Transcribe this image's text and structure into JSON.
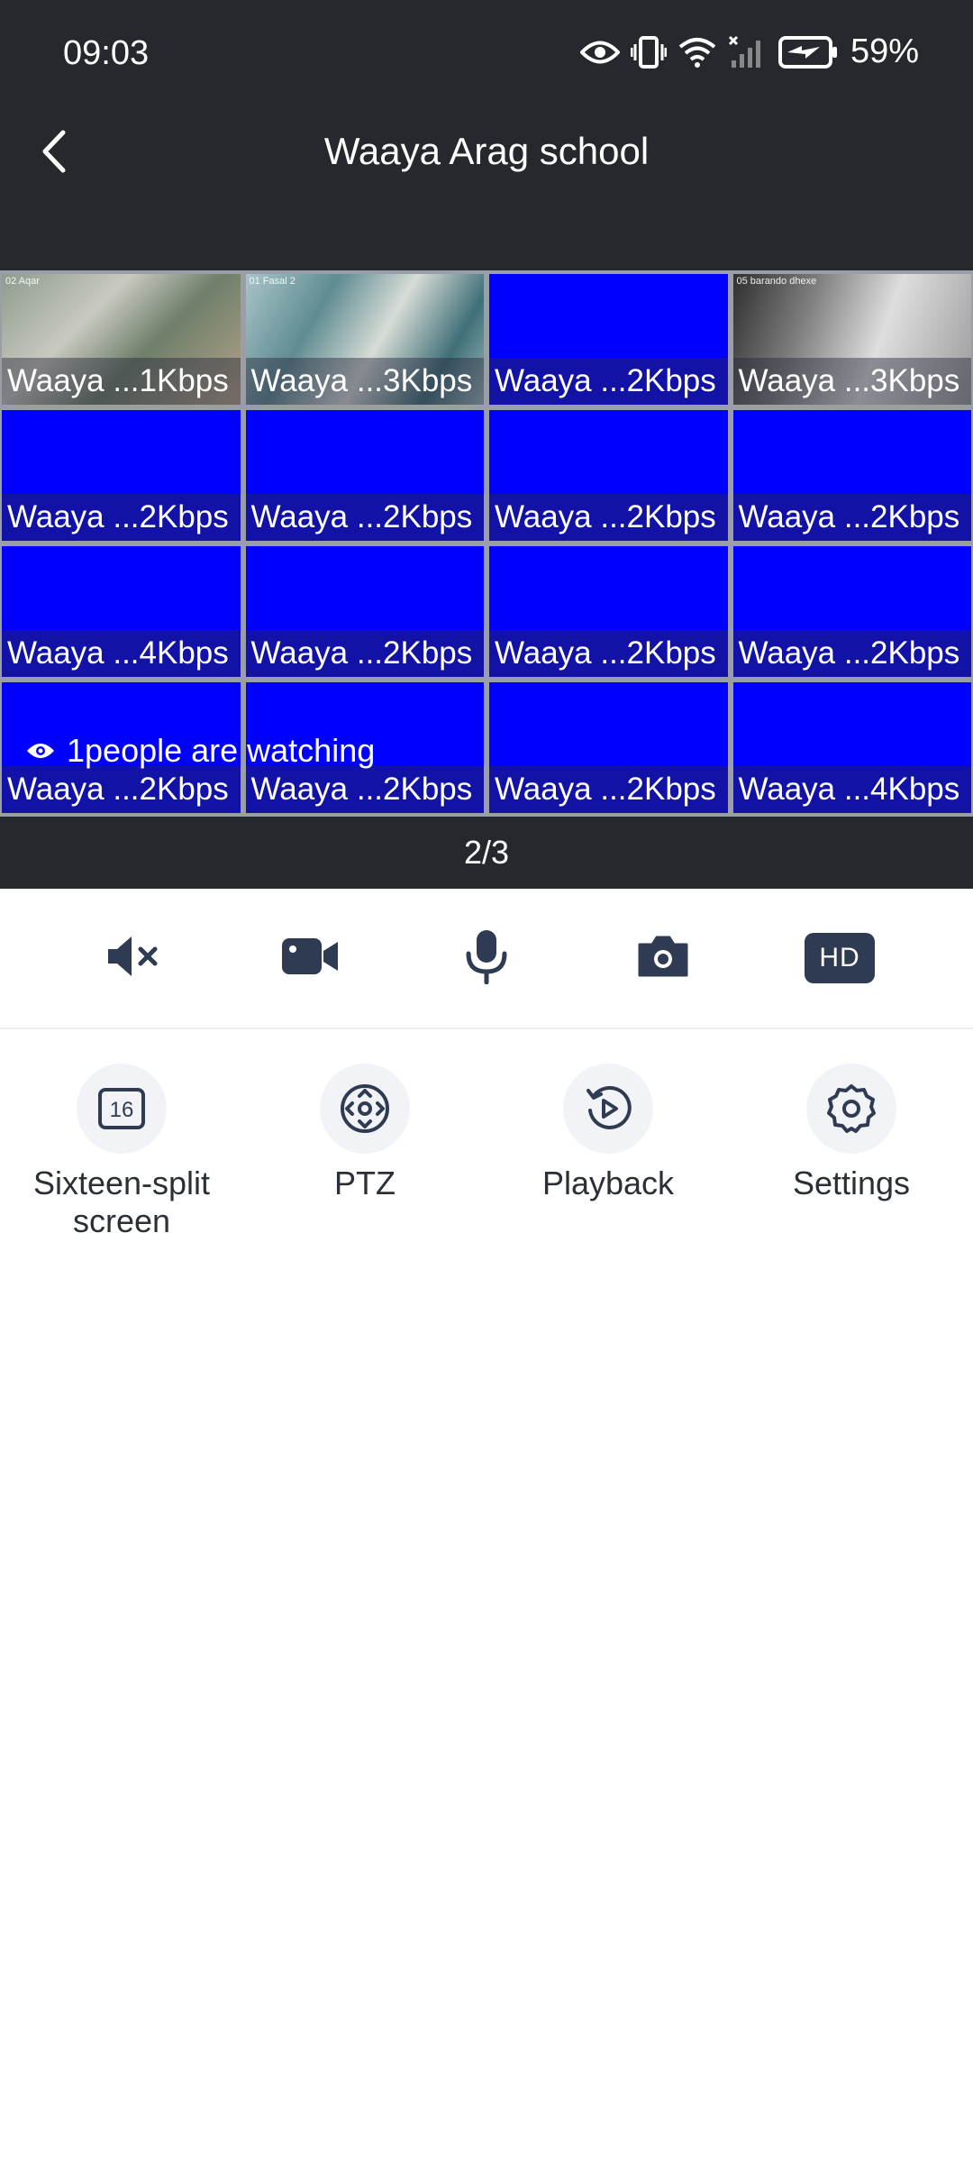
{
  "status_bar": {
    "time": "09:03",
    "battery": "59%",
    "icons": [
      "eye-icon",
      "vibrate-icon",
      "wifi-icon",
      "signal-icon",
      "battery-charging-icon"
    ]
  },
  "header": {
    "title": "Waaya Arag school",
    "back_icon": "chevron-left-icon"
  },
  "grid": {
    "tiles": [
      {
        "label": "Waaya ...1Kbps",
        "overlay": "02 Aqar"
      },
      {
        "label": "Waaya ...3Kbps",
        "overlay": "01 Fasal 2"
      },
      {
        "label": "Waaya ...2Kbps"
      },
      {
        "label": "Waaya ...3Kbps",
        "overlay": "05 barando dhexe"
      },
      {
        "label": "Waaya ...2Kbps"
      },
      {
        "label": "Waaya ...2Kbps"
      },
      {
        "label": "Waaya ...2Kbps"
      },
      {
        "label": "Waaya ...2Kbps"
      },
      {
        "label": "Waaya ...4Kbps"
      },
      {
        "label": "Waaya ...2Kbps"
      },
      {
        "label": "Waaya ...2Kbps"
      },
      {
        "label": "Waaya ...2Kbps"
      },
      {
        "label": "Waaya ...2Kbps"
      },
      {
        "label": "Waaya ...2Kbps"
      },
      {
        "label": "Waaya ...2Kbps"
      },
      {
        "label": "Waaya ...4Kbps"
      }
    ],
    "watching": "1people are watching"
  },
  "page_indicator": "2/3",
  "controls": {
    "items": [
      "mute-icon",
      "video-record-icon",
      "microphone-icon",
      "camera-snapshot-icon"
    ],
    "hd_label": "HD"
  },
  "menu": {
    "items": [
      {
        "label": "Sixteen-split screen",
        "icon": "sixteen-split-icon",
        "icon_text": "16"
      },
      {
        "label": "PTZ",
        "icon": "ptz-icon"
      },
      {
        "label": "Playback",
        "icon": "playback-icon"
      },
      {
        "label": "Settings",
        "icon": "settings-icon"
      }
    ]
  },
  "colors": {
    "header_bg": "#25282d",
    "tile_blue": "#0000fe",
    "hd_bg": "#2f3b52",
    "icon_dark": "#2f3b52"
  }
}
